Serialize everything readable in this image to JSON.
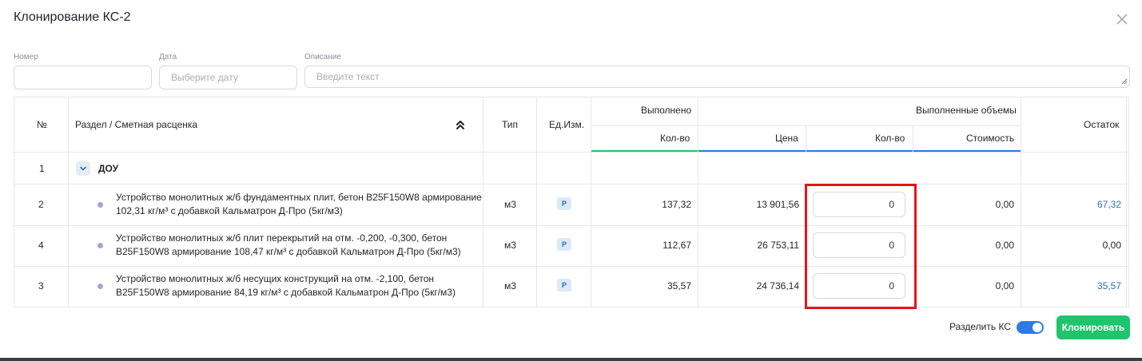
{
  "dialog": {
    "title": "Клонирование КС-2"
  },
  "form": {
    "number": {
      "label": "Номер",
      "value": "",
      "placeholder": ""
    },
    "date": {
      "label": "Дата",
      "placeholder": "Выберите дату"
    },
    "description": {
      "label": "Описание",
      "placeholder": "Введите текст"
    }
  },
  "table": {
    "headers": {
      "num": "№",
      "section": "Раздел / Сметная расценка",
      "type": "Тип",
      "unit": "Ед.Изм.",
      "done": "Выполнено",
      "done_qty": "Кол-во",
      "volumes": "Выполненные объемы",
      "price": "Цена",
      "qty": "Кол-во",
      "cost": "Стоимость",
      "rest": "Остаток"
    },
    "group": {
      "num": "1",
      "name": "ДОУ"
    },
    "rows": [
      {
        "num": "2",
        "desc_line1": "Устройство монолитных ж/б фундаментных плит, бетон В25F150W8 армирование",
        "desc_line2": "102,31 кг/м³ с добавкой Кальматрон Д-Про (5кг/м3)",
        "type": "м3",
        "unit": "Р",
        "done_qty": "137,32",
        "price": "13 901,56",
        "qty": "0",
        "cost": "0,00",
        "rest": "67,32"
      },
      {
        "num": "4",
        "desc_line1": "Устройство монолитных ж/б плит перекрытий на отм. -0,200, -0,300, бетон",
        "desc_line2": "В25F150W8 армирование 108,47 кг/м³ с добавкой Кальматрон Д-Про (5кг/м3)",
        "type": "м3",
        "unit": "Р",
        "done_qty": "112,67",
        "price": "26 753,11",
        "qty": "0",
        "cost": "0,00",
        "rest": "0,00"
      },
      {
        "num": "3",
        "desc_line1": "Устройство монолитных ж/б несущих конструкций на отм. -2,100, бетон",
        "desc_line2": "В25F150W8 армирование 84,19 кг/м³ с добавкой Кальматрон Д-Про (5кг/м3)",
        "type": "м3",
        "unit": "Р",
        "done_qty": "35,57",
        "price": "24 736,14",
        "qty": "0",
        "cost": "0,00",
        "rest": "35,57"
      }
    ]
  },
  "footer": {
    "split_label": "Разделить КС",
    "split_enabled": true,
    "clone_button": "Клонировать"
  },
  "colors": {
    "accent_blue": "#2c7be5",
    "accent_green": "#1fc46d",
    "highlight_red": "#e3141b",
    "link_blue": "#2b6fb8"
  },
  "icons": {
    "close": "close-icon",
    "sort": "double-chevron-up-icon",
    "expand": "chevron-down-icon",
    "row_marker": "dot-icon"
  }
}
